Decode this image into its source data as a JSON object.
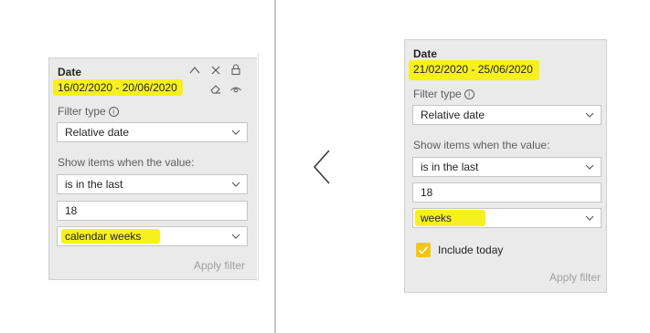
{
  "left_panel": {
    "title": "Date",
    "range": "16/02/2020 - 20/06/2020",
    "filter_type_label": "Filter type",
    "filter_type_value": "Relative date",
    "show_items_label": "Show items when the value:",
    "condition_value": "is in the last",
    "number_value": "18",
    "unit_value": "calendar weeks",
    "apply_label": "Apply filter"
  },
  "right_panel": {
    "title": "Date",
    "range": "21/02/2020 - 25/06/2020",
    "filter_type_label": "Filter type",
    "filter_type_value": "Relative date",
    "show_items_label": "Show items when the value:",
    "condition_value": "is in the last",
    "number_value": "18",
    "unit_value": "weeks",
    "include_today_label": "Include today",
    "include_today_checked": true,
    "apply_label": "Apply filter"
  },
  "colors": {
    "highlight": "#f7f01f",
    "card_background": "#eaeaea",
    "checkbox": "#f2c811"
  },
  "icons": [
    "collapse-chevron-icon",
    "close-icon",
    "lock-icon",
    "eraser-icon",
    "eye-icon",
    "info-icon",
    "chevron-down-icon",
    "back-arrow-icon"
  ]
}
